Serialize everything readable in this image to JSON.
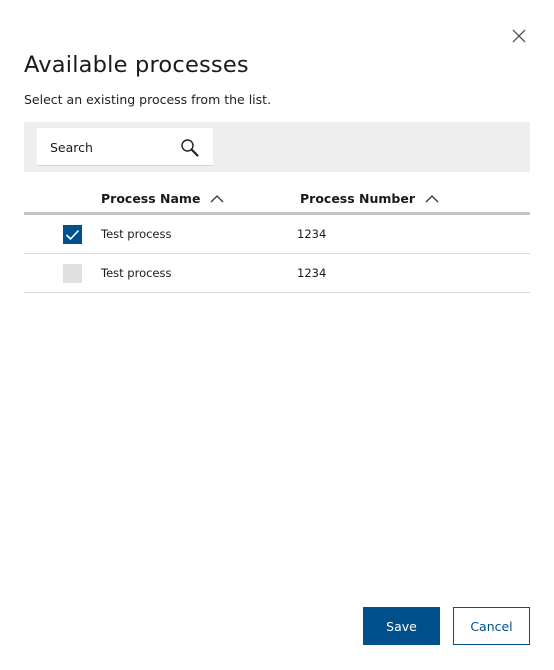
{
  "dialog": {
    "title": "Available processes",
    "subtitle": "Select an existing process from the list."
  },
  "search": {
    "placeholder": "Search",
    "value": ""
  },
  "table": {
    "columns": [
      {
        "label": "Process Name",
        "sort": "ascending"
      },
      {
        "label": "Process Number",
        "sort": "ascending"
      }
    ],
    "rows": [
      {
        "checked": true,
        "name": "Test process",
        "number": "1234"
      },
      {
        "checked": false,
        "name": "Test process",
        "number": "1234"
      }
    ]
  },
  "actions": {
    "save_label": "Save",
    "cancel_label": "Cancel"
  },
  "colors": {
    "primary": "#00508c",
    "toolbar_bg": "#eeeeee",
    "unchecked_bg": "#e0e0e0"
  },
  "icons": {
    "close": "close-icon",
    "search": "search-icon",
    "sort": "chevron-up-icon",
    "check": "checkmark-icon"
  }
}
